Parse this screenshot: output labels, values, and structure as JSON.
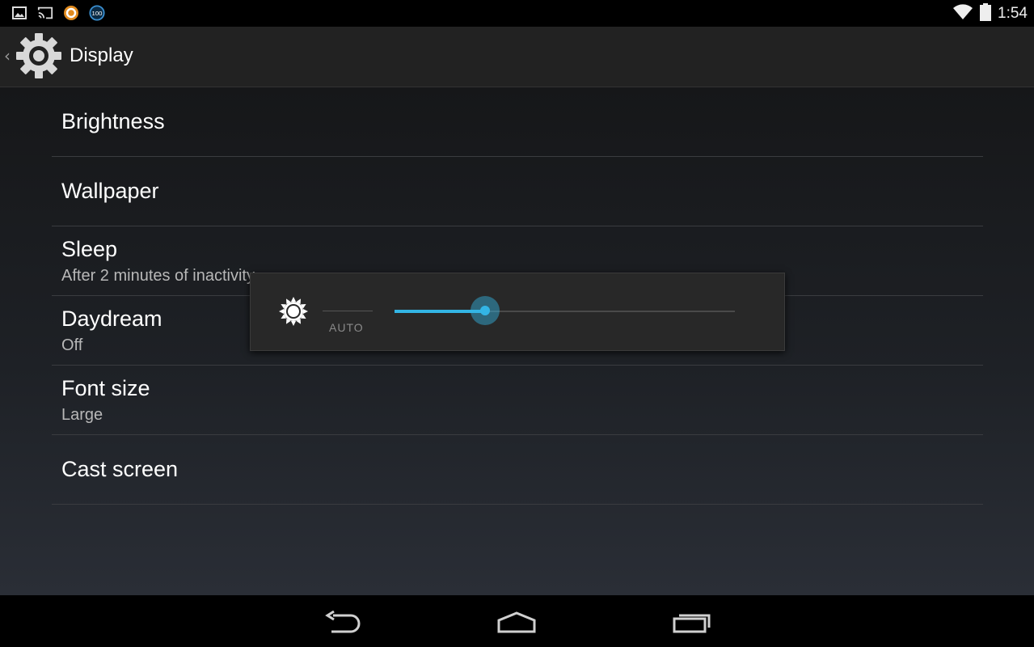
{
  "status_bar": {
    "time": "1:54",
    "notification_icons": [
      "gallery-icon",
      "cast-icon",
      "app-orange-icon",
      "battery-100-badge-icon"
    ],
    "badge_text": "100",
    "system_icons": [
      "wifi-icon",
      "battery-icon"
    ]
  },
  "action_bar": {
    "title": "Display",
    "icon": "settings-gear-icon"
  },
  "settings": {
    "items": [
      {
        "title": "Brightness",
        "summary": ""
      },
      {
        "title": "Wallpaper",
        "summary": ""
      },
      {
        "title": "Sleep",
        "summary": "After 2 minutes of inactivity"
      },
      {
        "title": "Daydream",
        "summary": "Off"
      },
      {
        "title": "Font size",
        "summary": "Large"
      },
      {
        "title": "Cast screen",
        "summary": ""
      }
    ]
  },
  "brightness_dialog": {
    "auto_label": "AUTO",
    "level_fraction": 0.265,
    "icon": "brightness-sun-icon"
  },
  "navigation_bar": {
    "buttons": [
      "back-icon",
      "home-icon",
      "recent-apps-icon"
    ]
  },
  "colors": {
    "accent": "#33b5e5",
    "action_bar_bg": "#222222"
  }
}
